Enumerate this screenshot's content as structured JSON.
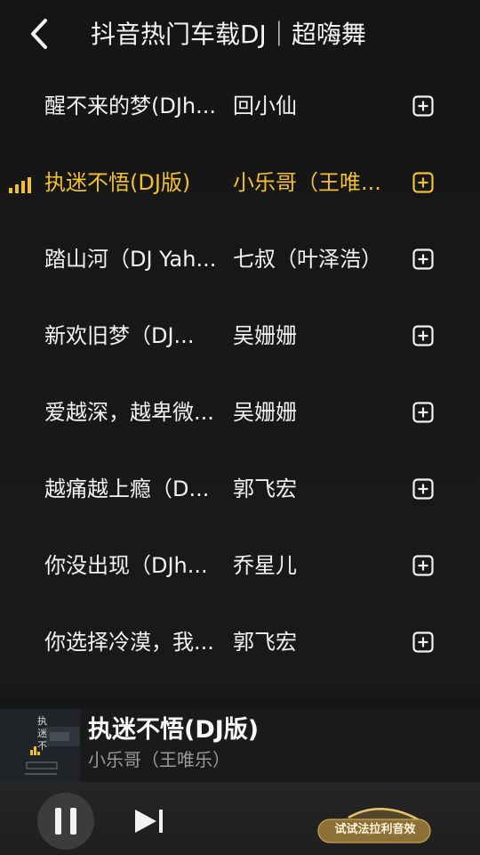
{
  "header": {
    "title": "抖音热门车载DJ｜超嗨舞",
    "back_icon": "chevron-left-icon"
  },
  "songs": [
    {
      "title": "醒不来的梦(DJh...",
      "artist": "回小仙"
    },
    {
      "title": "执迷不悟(DJ版)",
      "artist": "小乐哥（王唯...",
      "playing": true
    },
    {
      "title": "踏山河（DJ Yah...",
      "artist": "七叔（叶泽浩）"
    },
    {
      "title": "新欢旧梦（DJ...",
      "artist": "吴姗姗"
    },
    {
      "title": "爱越深，越卑微...",
      "artist": "吴姗姗"
    },
    {
      "title": "越痛越上瘾（D...",
      "artist": "郭飞宏"
    },
    {
      "title": "你没出现（DJh...",
      "artist": "乔星儿"
    },
    {
      "title": "你选择冷漠，我...",
      "artist": "郭飞宏"
    }
  ],
  "now_playing": {
    "title": "执迷不悟(DJ版)",
    "artist": "小乐哥（王唯乐）",
    "cover_text": "执迷不悟"
  },
  "controls": {
    "pause_icon": "pause-icon",
    "next_icon": "skip-next-icon",
    "promo_label": "试试法拉利音效"
  },
  "colors": {
    "background": "#151515",
    "accent": "#f2c02f",
    "text": "#f2f2f2",
    "muted": "#9a9a9a"
  }
}
